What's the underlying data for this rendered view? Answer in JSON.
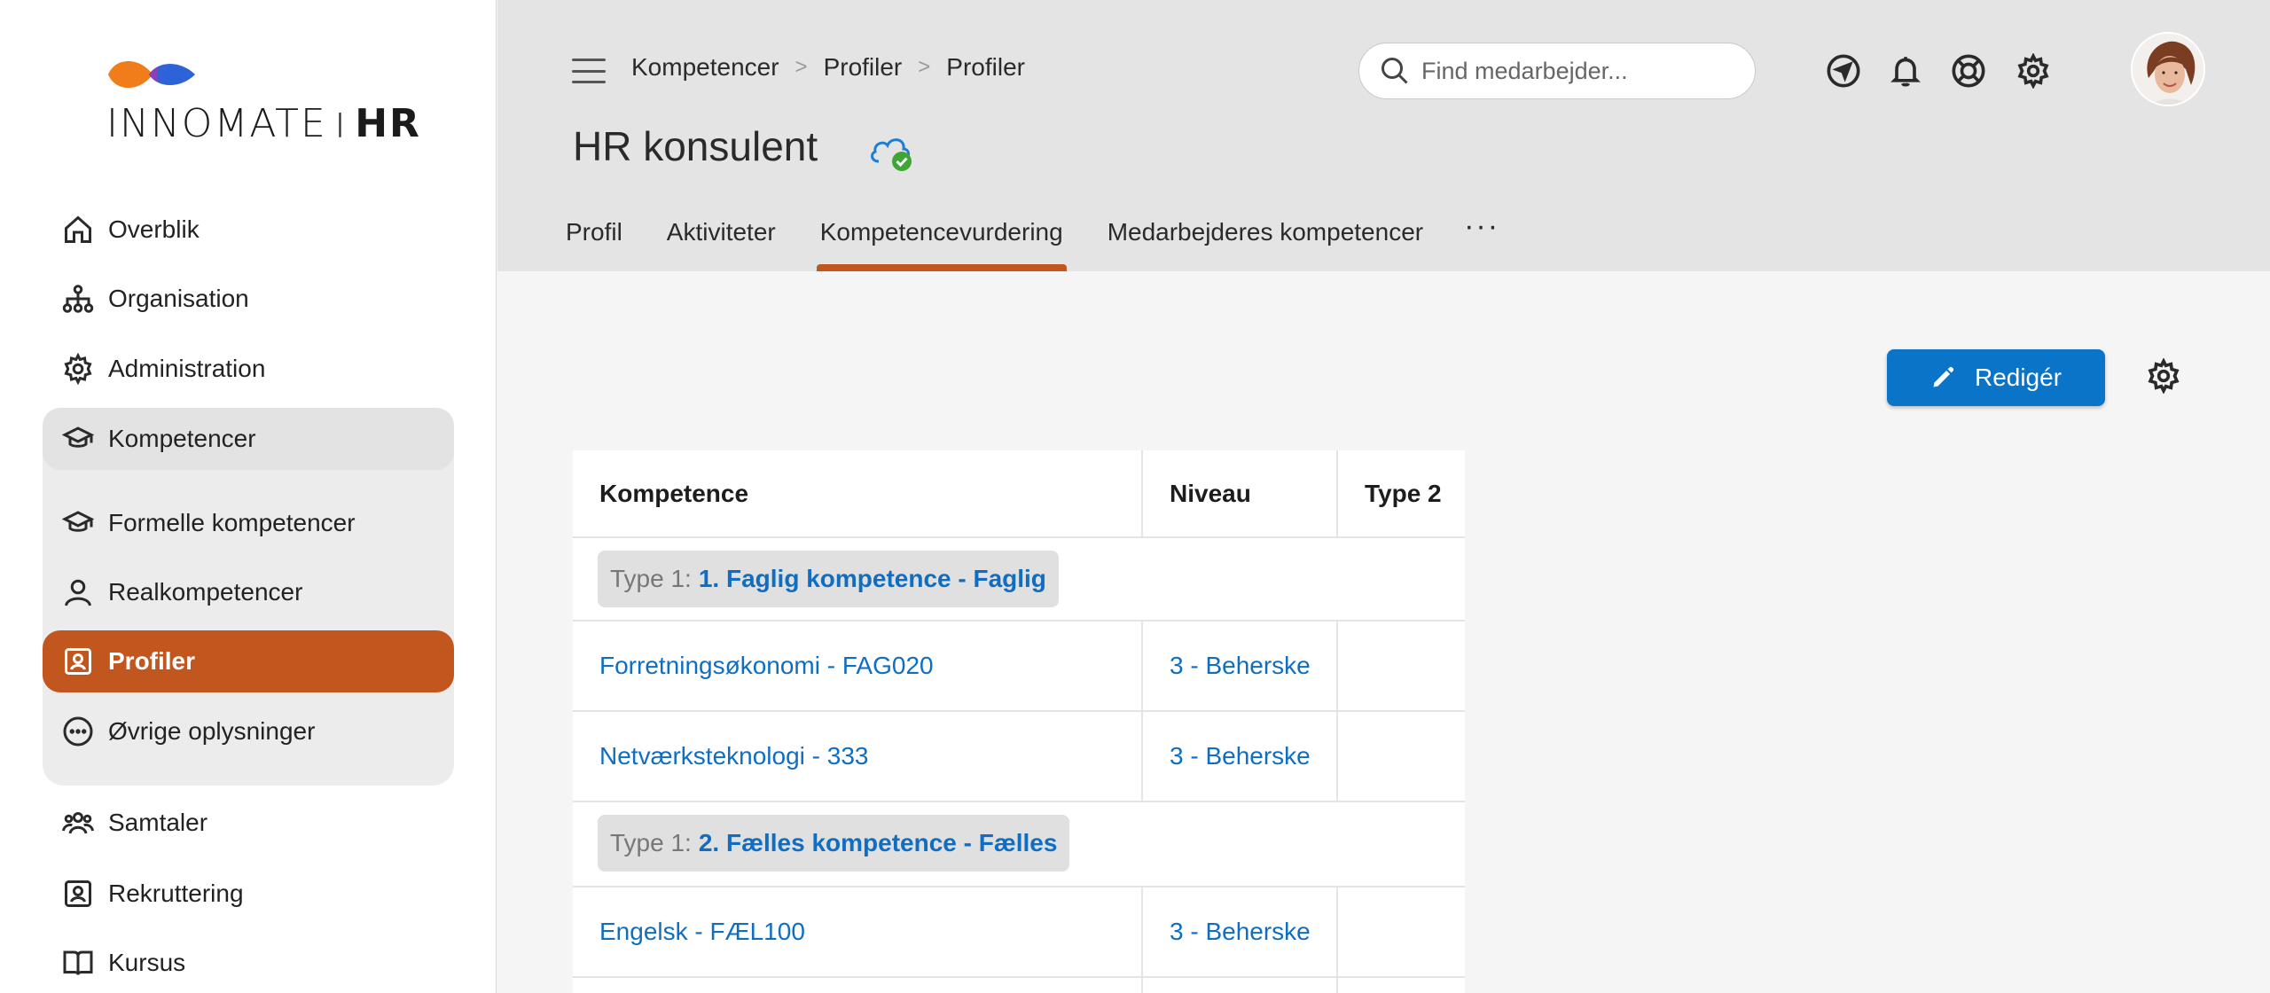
{
  "app": {
    "logo_primary": "INNOMATE",
    "logo_separator": "|",
    "logo_secondary": "HR",
    "brand_color": "#c1571e",
    "accent_color": "#0a74c9"
  },
  "sidebar": {
    "items": [
      {
        "label": "Overblik",
        "icon": "home-icon"
      },
      {
        "label": "Organisation",
        "icon": "org-chart-icon"
      },
      {
        "label": "Administration",
        "icon": "gear-icon"
      },
      {
        "label": "Kompetencer",
        "icon": "graduation-cap-icon"
      },
      {
        "label": "Formelle kompetencer",
        "icon": "graduation-cap-icon"
      },
      {
        "label": "Realkompetencer",
        "icon": "person-icon"
      },
      {
        "label": "Profiler",
        "icon": "profile-badge-icon"
      },
      {
        "label": "Øvrige oplysninger",
        "icon": "more-circle-icon"
      },
      {
        "label": "Samtaler",
        "icon": "people-icon"
      },
      {
        "label": "Rekruttering",
        "icon": "profile-badge-icon"
      },
      {
        "label": "Kursus",
        "icon": "book-icon"
      }
    ],
    "active": "Profiler",
    "expanded_parent": "Kompetencer"
  },
  "header": {
    "breadcrumb": [
      "Kompetencer",
      "Profiler",
      "Profiler"
    ],
    "title": "HR konsulent",
    "sync_status_icon": "cloud-check-icon",
    "search_placeholder": "Find medarbejder...",
    "icons": [
      "navigation-icon",
      "bell-icon",
      "lifebuoy-icon",
      "gear-icon"
    ]
  },
  "tabs": {
    "items": [
      "Profil",
      "Aktiviteter",
      "Kompetencevurdering",
      "Medarbejderes kompetencer"
    ],
    "active": "Kompetencevurdering",
    "more_label": "···"
  },
  "toolbar": {
    "edit_label": "Redigér"
  },
  "table": {
    "columns": [
      "Kompetence",
      "Niveau",
      "Type 2"
    ],
    "groups": [
      {
        "type_label": "Type 1:",
        "name": "1. Faglig kompetence - Faglig",
        "rows": [
          {
            "kompetence": "Forretningsøkonomi - FAG020",
            "niveau": "3 - Beherske",
            "type2": ""
          },
          {
            "kompetence": "Netværksteknologi - 333",
            "niveau": "3 - Beherske",
            "type2": ""
          }
        ]
      },
      {
        "type_label": "Type 1:",
        "name": "2. Fælles kompetence - Fælles",
        "rows": [
          {
            "kompetence": "Engelsk - FÆL100",
            "niveau": "3 - Beherske",
            "type2": ""
          }
        ]
      }
    ]
  }
}
